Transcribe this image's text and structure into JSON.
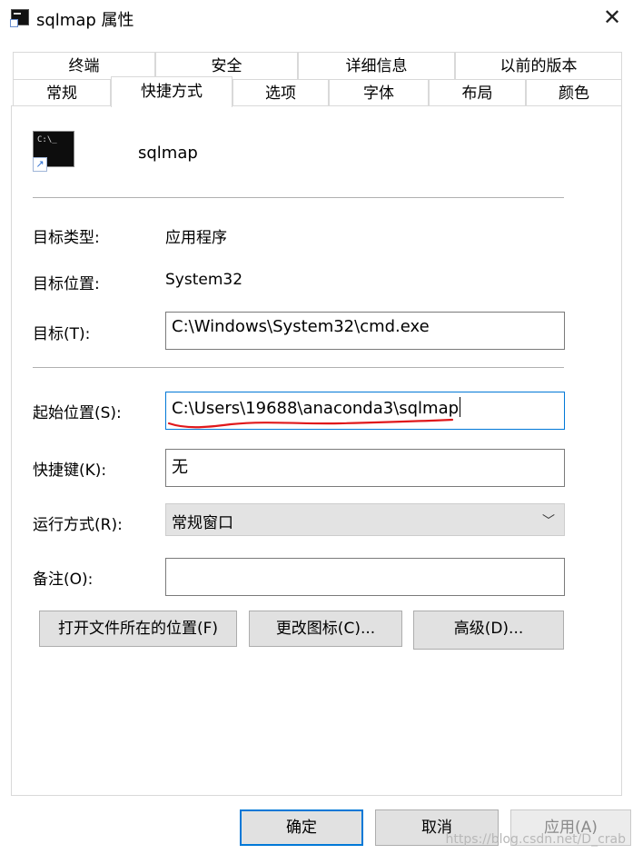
{
  "window": {
    "title": "sqlmap 属性",
    "close_glyph": "✕",
    "icon": "cmd-icon"
  },
  "tabs_row1": [
    {
      "label": "终端"
    },
    {
      "label": "安全"
    },
    {
      "label": "详细信息"
    },
    {
      "label": "以前的版本"
    }
  ],
  "tabs_row2": [
    {
      "label": "常规"
    },
    {
      "label": "快捷方式",
      "active": true
    },
    {
      "label": "选项"
    },
    {
      "label": "字体"
    },
    {
      "label": "布局"
    },
    {
      "label": "颜色"
    }
  ],
  "shortcut": {
    "name": "sqlmap",
    "icon_text": "C:\\_",
    "target_type_label": "目标类型:",
    "target_type_value": "应用程序",
    "target_location_label": "目标位置:",
    "target_location_value": "System32",
    "target_label": "目标(T):",
    "target_value": "C:\\Windows\\System32\\cmd.exe",
    "start_in_label": "起始位置(S):",
    "start_in_value": "C:\\Users\\19688\\anaconda3\\sqlmap",
    "hotkey_label": "快捷键(K):",
    "hotkey_value": "无",
    "run_label": "运行方式(R):",
    "run_value": "常规窗口",
    "comment_label": "备注(O):",
    "comment_value": ""
  },
  "action_buttons": {
    "open_location": "打开文件所在的位置(F)",
    "change_icon": "更改图标(C)...",
    "advanced": "高级(D)..."
  },
  "footer": {
    "ok": "确定",
    "cancel": "取消",
    "apply": "应用(A)"
  },
  "annotation": {
    "underline_color": "#e0181b"
  },
  "watermark": "https://blog.csdn.net/D_crab"
}
